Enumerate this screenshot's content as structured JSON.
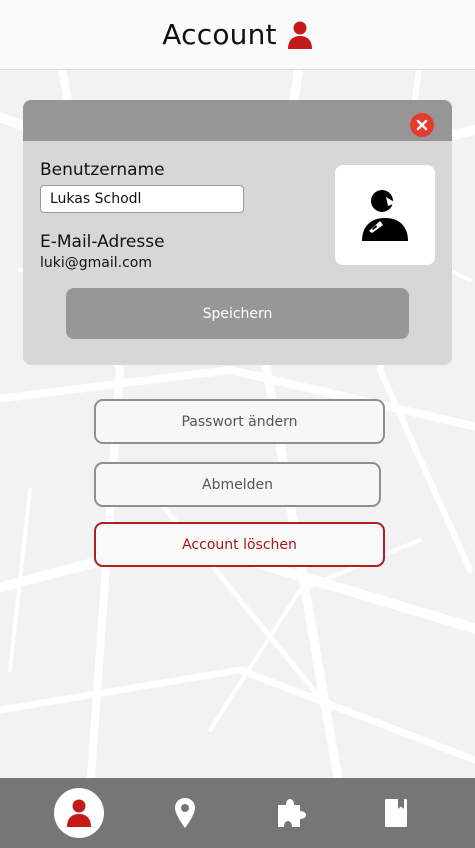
{
  "header": {
    "title": "Account",
    "icon": "user-icon",
    "accent": "#c41a1a"
  },
  "card": {
    "close_icon": "close-icon",
    "username_label": "Benutzername",
    "username_value": "Lukas Schodl",
    "email_label": "E-Mail-Adresse",
    "email_value": "luki@gmail.com",
    "avatar_icon": "user-avatar-icon",
    "save_label": "Speichern"
  },
  "actions": {
    "change_password": "Passwort ändern",
    "logout": "Abmelden",
    "delete_account": "Account löschen"
  },
  "nav": {
    "items": [
      {
        "icon": "user-icon",
        "active": true
      },
      {
        "icon": "map-pin-icon",
        "active": false
      },
      {
        "icon": "puzzle-icon",
        "active": false
      },
      {
        "icon": "book-icon",
        "active": false
      }
    ]
  },
  "colors": {
    "accent_red": "#c41a1a",
    "close_red": "#e33b2e",
    "card_bg": "#d7d7d7",
    "card_bar": "#969696",
    "nav_bg": "#767676"
  }
}
